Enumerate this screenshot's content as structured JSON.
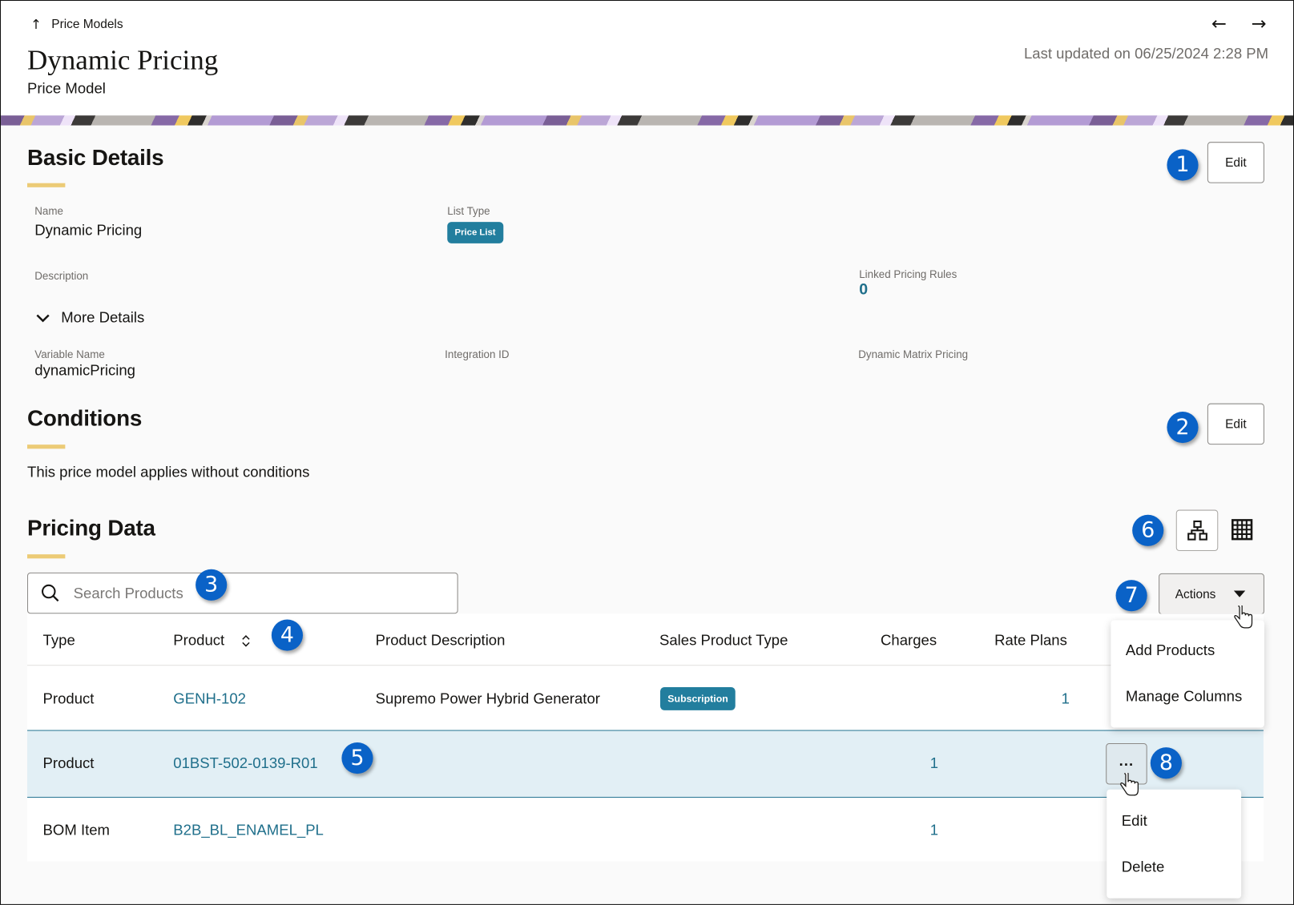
{
  "header": {
    "back_icon": "arrow-up-icon",
    "back_label": "Price Models",
    "title": "Dynamic Pricing",
    "subtitle": "Price Model",
    "prev_icon": "←",
    "next_icon": "→",
    "last_updated": "Last updated on 06/25/2024 2:28 PM"
  },
  "basic_details": {
    "title": "Basic Details",
    "edit_label": "Edit",
    "fields": {
      "name_label": "Name",
      "name_value": "Dynamic Pricing",
      "list_type_label": "List Type",
      "list_type_value": "Price List",
      "description_label": "Description",
      "linked_rules_label": "Linked Pricing Rules",
      "linked_rules_value": "0",
      "more_details_label": "More Details",
      "variable_name_label": "Variable Name",
      "variable_name_value": "dynamicPricing",
      "integration_id_label": "Integration ID",
      "dynamic_matrix_label": "Dynamic Matrix Pricing"
    }
  },
  "conditions": {
    "title": "Conditions",
    "edit_label": "Edit",
    "text": "This price model applies without conditions"
  },
  "pricing_data": {
    "title": "Pricing Data",
    "search_placeholder": "Search Products",
    "actions_label": "Actions",
    "actions_menu": [
      "Add Products",
      "Manage Columns"
    ],
    "columns": [
      "Type",
      "Product",
      "Product Description",
      "Sales Product Type",
      "Charges",
      "Rate Plans"
    ],
    "rows": [
      {
        "type": "Product",
        "product": "GENH-102",
        "description": "Supremo Power Hybrid Generator",
        "sales_type": "Subscription",
        "charges": "",
        "rate_plans": "1"
      },
      {
        "type": "Product",
        "product": "01BST-502-0139-R01",
        "description": "",
        "sales_type": "",
        "charges": "1",
        "rate_plans": ""
      },
      {
        "type": "BOM Item",
        "product": "B2B_BL_ENAMEL_PL",
        "description": "",
        "sales_type": "",
        "charges": "1",
        "rate_plans": ""
      }
    ],
    "row_menu_button": "...",
    "row_menu": [
      "Edit",
      "Delete"
    ]
  },
  "callouts": [
    "1",
    "2",
    "3",
    "4",
    "5",
    "6",
    "7",
    "8"
  ],
  "colors": {
    "accent_bar": "#eccb76",
    "badge": "#227e9e",
    "link": "#1f6f8b",
    "callout": "#0a62c7",
    "selected_row": "#e2eff5"
  }
}
